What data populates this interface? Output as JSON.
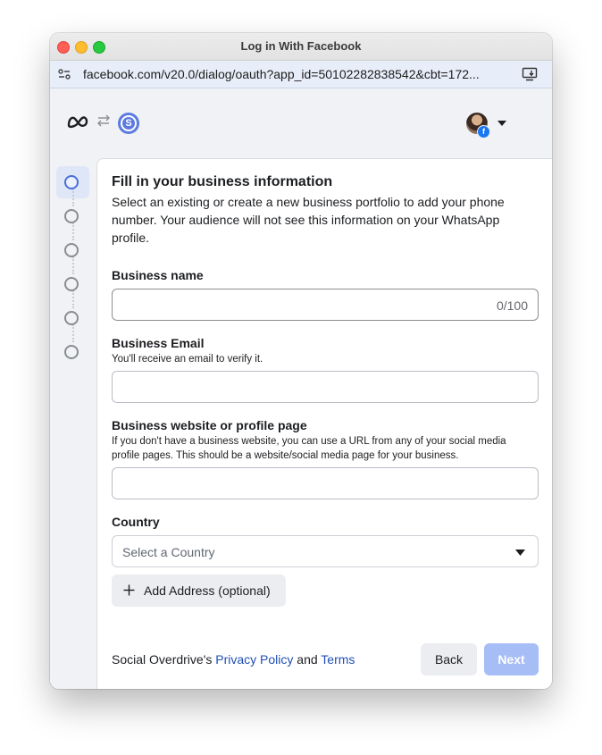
{
  "window": {
    "title": "Log in With Facebook",
    "url": "facebook.com/v20.0/dialog/oauth?app_id=50102282838542&cbt=172..."
  },
  "header": {
    "app_initial": "S",
    "fb_badge": "f"
  },
  "stepper": {
    "steps": 6,
    "active_step": 1
  },
  "form": {
    "title": "Fill in your business information",
    "description": "Select an existing or create a new business portfolio to add your phone number. Your audience will not see this information on your WhatsApp profile.",
    "business_name": {
      "label": "Business name",
      "value": "",
      "counter": "0/100"
    },
    "business_email": {
      "label": "Business Email",
      "help": "You'll receive an email to verify it.",
      "value": ""
    },
    "business_website": {
      "label": "Business website or profile page",
      "help": "If you don't have a business website, you can use a URL from any of your social media profile pages. This should be a website/social media page for your business.",
      "value": ""
    },
    "country": {
      "label": "Country",
      "selected": "Select a Country"
    },
    "add_address_label": "Add Address (optional)"
  },
  "footer": {
    "prefix": "Social Overdrive's ",
    "privacy_link": "Privacy Policy",
    "and": " and ",
    "terms_link": "Terms",
    "back_label": "Back",
    "next_label": "Next"
  },
  "colors": {
    "accent": "#4a6fd6",
    "link": "#1f4fb5",
    "next_disabled": "#a6bdf5",
    "facebook_blue": "#1877f2"
  }
}
